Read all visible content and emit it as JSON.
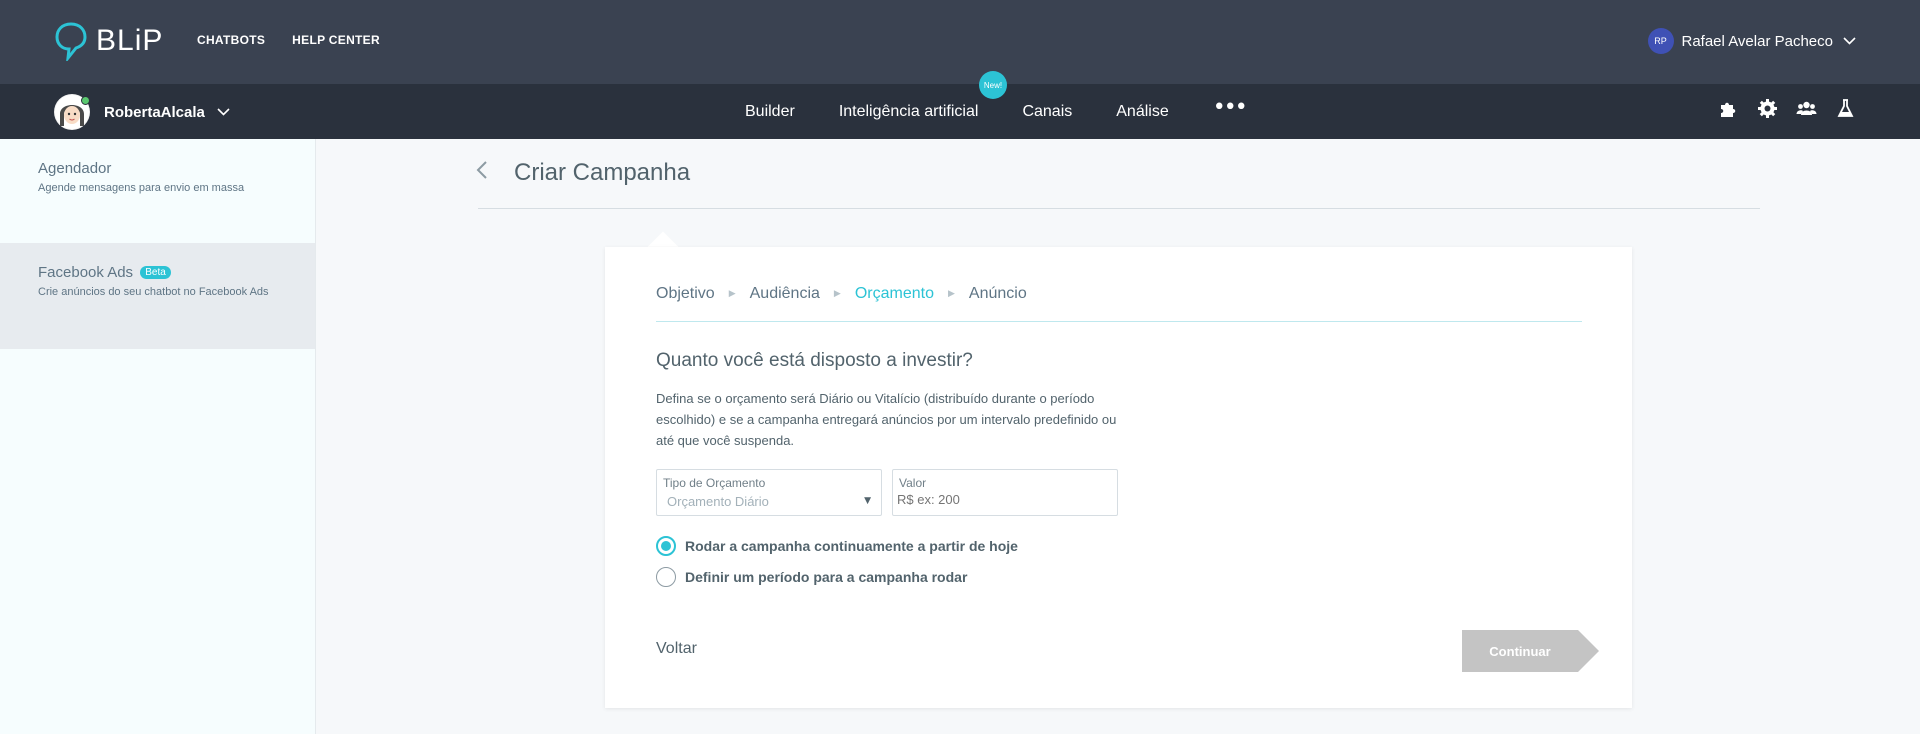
{
  "topbar": {
    "logo_text": "BLiP",
    "nav": [
      "CHATBOTS",
      "HELP CENTER"
    ],
    "user": {
      "initials": "RP",
      "name": "Rafael Avelar Pacheco"
    }
  },
  "botbar": {
    "bot_name": "RobertaAlcala",
    "nav": [
      "Builder",
      "Inteligência artificial",
      "Canais",
      "Análise"
    ],
    "new_badge": "New!",
    "more": "•••",
    "tools": [
      "puzzle-icon",
      "gear-icon",
      "users-icon",
      "flask-icon"
    ]
  },
  "sidebar": {
    "items": [
      {
        "title": "Agendador",
        "description": "Agende mensagens para envio em massa"
      },
      {
        "title": "Facebook Ads",
        "badge": "Beta",
        "description": "Crie anúncios do seu chatbot no Facebook Ads"
      }
    ]
  },
  "page": {
    "title": "Criar Campanha"
  },
  "wizard": {
    "steps": [
      "Objetivo",
      "Audiência",
      "Orçamento",
      "Anúncio"
    ],
    "active_step": "Orçamento",
    "question": "Quanto você está disposto a investir?",
    "description": "Defina se o orçamento será Diário ou Vitalício (distribuído durante o período escolhido) e se a campanha entregará anúncios por um intervalo predefinido ou até que você suspenda.",
    "budget_type": {
      "label": "Tipo de Orçamento",
      "value": "Orçamento Diário"
    },
    "amount": {
      "label": "Valor",
      "placeholder": "R$ ex: 200"
    },
    "options": [
      {
        "label": "Rodar a campanha continuamente a partir de hoje",
        "checked": true
      },
      {
        "label": "Definir um período para a campanha rodar",
        "checked": false
      }
    ],
    "back_label": "Voltar",
    "continue_label": "Continuar"
  },
  "colors": {
    "accent": "#2cc3d5",
    "topbar": "#3a4251",
    "botbar": "#2a313d",
    "disabled_button": "#c4c4c4"
  }
}
